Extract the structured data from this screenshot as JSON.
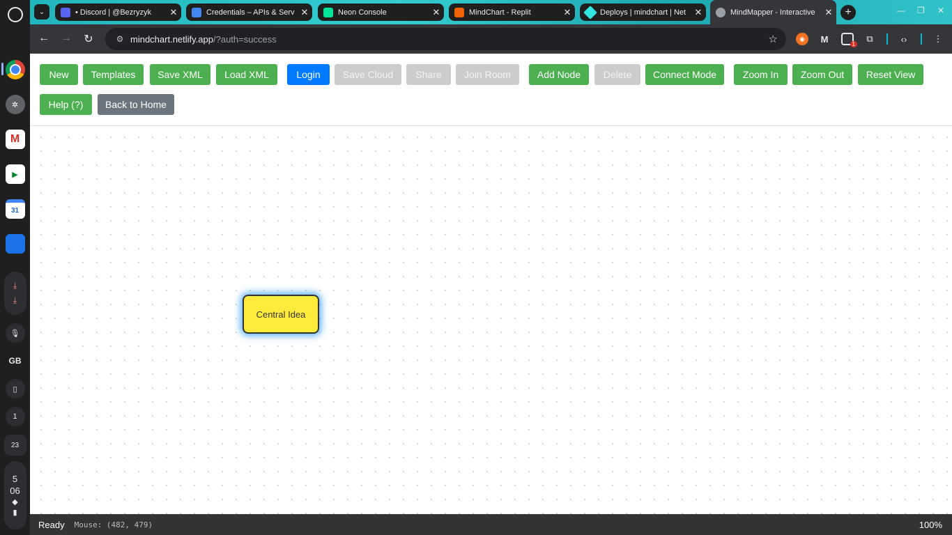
{
  "shelf": {
    "tray_lang": "GB",
    "notification_count": "1",
    "date": "23",
    "time_hour": "5",
    "time_min": "06"
  },
  "browser": {
    "tabs": [
      {
        "title": "• Discord | @Bezryzyk",
        "color": "#5865f2"
      },
      {
        "title": "Credentials – APIs & Serv",
        "color": "#4285f4"
      },
      {
        "title": "Neon Console",
        "color": "#00e599"
      },
      {
        "title": "MindChart - Replit",
        "color": "#f26207"
      },
      {
        "title": "Deploys | mindchart | Net",
        "color": "#32e6e2"
      },
      {
        "title": "MindMapper - Interactive",
        "color": "#9aa0a6"
      }
    ],
    "url_host": "mindchart.netlify.app",
    "url_path": "/?auth=success",
    "ext_badge": "1"
  },
  "app": {
    "buttons": {
      "new": "New",
      "templates": "Templates",
      "save_xml": "Save XML",
      "load_xml": "Load XML",
      "login": "Login",
      "save_cloud": "Save Cloud",
      "share": "Share",
      "join_room": "Join Room",
      "add_node": "Add Node",
      "delete": "Delete",
      "connect_mode": "Connect Mode",
      "zoom_in": "Zoom In",
      "zoom_out": "Zoom Out",
      "reset_view": "Reset View",
      "help": "Help (?)",
      "back_home": "Back to Home"
    },
    "node": {
      "text": "Central Idea",
      "fill": "#ffeb3b"
    },
    "status": {
      "state": "Ready",
      "mouse": "Mouse: (482, 479)",
      "zoom": "100%"
    },
    "colors": {
      "primary": "#4caf50",
      "login": "#007bff",
      "disabled": "#cccccc",
      "secondary": "#6c757d"
    }
  }
}
